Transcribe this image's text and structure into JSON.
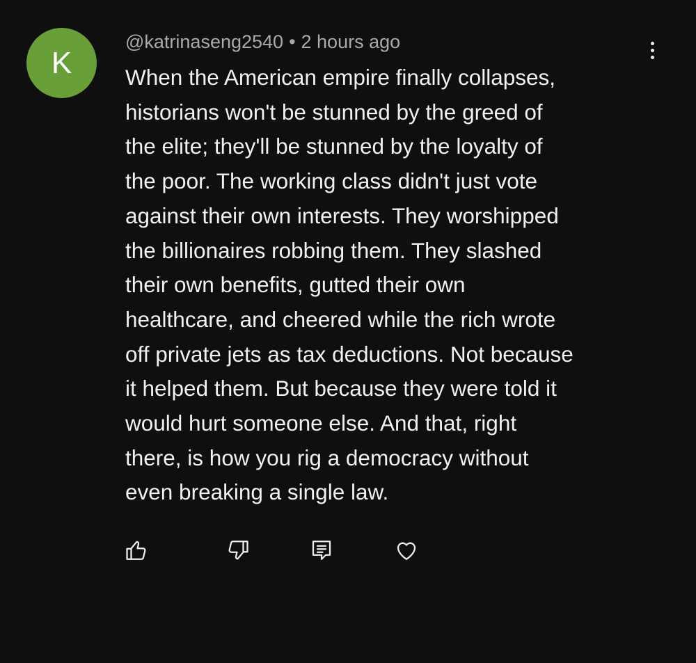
{
  "colors": {
    "background": "#0f0f0f",
    "avatar_bg": "#689f38",
    "text_primary": "#f1f1f1",
    "text_secondary": "#aaaaaa"
  },
  "comment": {
    "avatar_letter": "K",
    "author": "@katrinaseng2540",
    "separator": "•",
    "timestamp": "2 hours ago",
    "lines": [
      "When the American empire finally collapses,",
      "historians won't be stunned by the greed of",
      "the elite; they'll be stunned by the loyalty of",
      "the poor. The working class didn't just vote",
      "against their own interests. They worshipped",
      "the billionaires robbing them. They slashed",
      "their own benefits, gutted their own",
      "healthcare, and cheered while the rich wrote",
      "off private jets as tax deductions. Not because",
      "it helped them. But because they were told it",
      "would hurt someone else. And that, right",
      "there, is how you rig a democracy without",
      "even breaking a single law."
    ]
  },
  "icons": {
    "menu": "more-vertical-icon",
    "like": "thumbs-up-icon",
    "dislike": "thumbs-down-icon",
    "reply": "comment-icon",
    "heart": "heart-icon"
  }
}
